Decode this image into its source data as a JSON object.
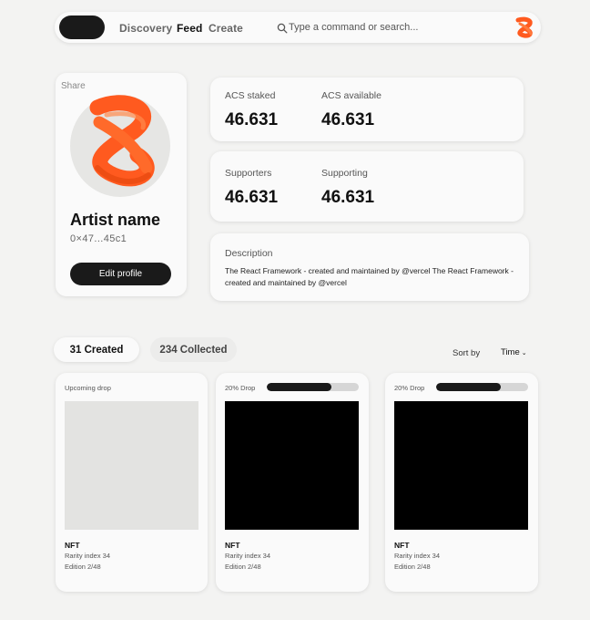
{
  "nav": {
    "links": {
      "discovery": "Discovery",
      "feed": "Feed",
      "create": "Create"
    },
    "active": "Feed",
    "search_placeholder": "Type a command or search..."
  },
  "profile": {
    "share": "Share",
    "artist_name": "Artist name",
    "wallet": "0×47...45c1",
    "edit_button": "Edit profile"
  },
  "stats": {
    "acs_staked": {
      "label": "ACS staked",
      "value": "46.631"
    },
    "acs_available": {
      "label": "ACS available",
      "value": "46.631"
    },
    "supporters": {
      "label": "Supporters",
      "value": "46.631"
    },
    "supporting": {
      "label": "Supporting",
      "value": "46.631"
    }
  },
  "description": {
    "label": "Description",
    "text": "The React Framework - created and maintained by @vercel The React Framework - created and maintained by @vercel"
  },
  "tabs": {
    "created": "31 Created",
    "collected": "234 Collected",
    "active": "created"
  },
  "sort": {
    "label": "Sort by",
    "value": "Time"
  },
  "nfts": [
    {
      "drop_label": "Upcoming drop",
      "title": "NFT",
      "rarity": "Rarity index 34",
      "edition": "Edition 2/48",
      "image_color": "#e3e3e1"
    },
    {
      "drop_label": "20% Drop",
      "progress": 0.7,
      "title": "NFT",
      "rarity": "Rarity index 34",
      "edition": "Edition 2/48",
      "image_color": "#000000"
    },
    {
      "drop_label": "20% Drop",
      "progress": 0.7,
      "title": "NFT",
      "rarity": "Rarity index 34",
      "edition": "Edition 2/48",
      "image_color": "#000000"
    }
  ],
  "colors": {
    "accent": "#ff5a1f",
    "dark": "#1a1a1a",
    "background": "#f3f3f2",
    "card": "#fafafa"
  },
  "icons": {
    "search": "search-icon",
    "avatar": "orange-swirl-avatar"
  }
}
